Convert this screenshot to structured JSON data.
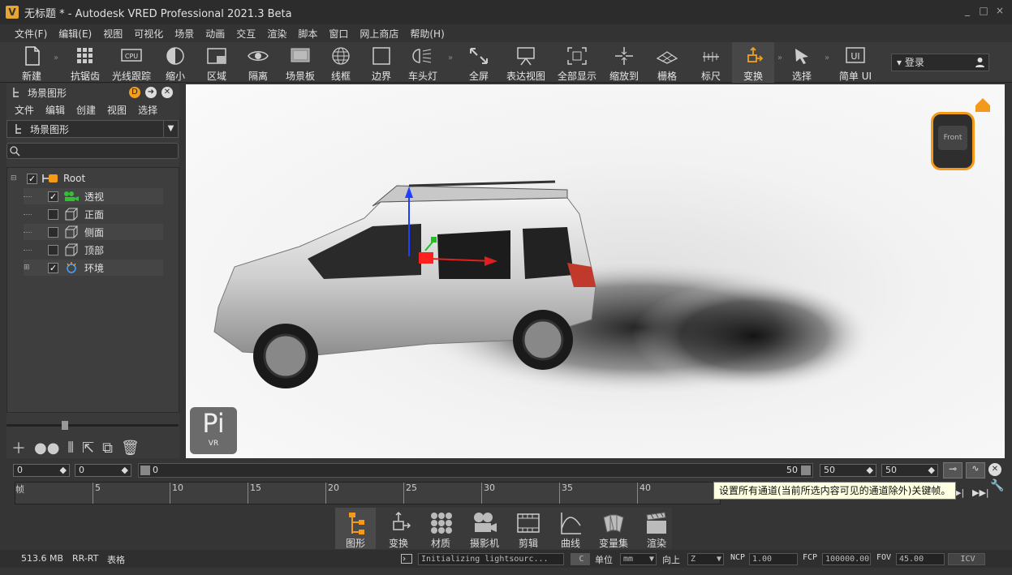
{
  "title": "无标题 * - Autodesk VRED Professional 2021.3 Beta",
  "logo_letter": "V",
  "window_controls": [
    "_",
    "□",
    "×"
  ],
  "menu": [
    "文件(F)",
    "编辑(E)",
    "视图",
    "可视化",
    "场景",
    "动画",
    "交互",
    "渲染",
    "脚本",
    "窗口",
    "网上商店",
    "帮助(H)"
  ],
  "toolbar": {
    "new": "新建",
    "antialias": "抗锯齿",
    "raytrace": "光线跟踪",
    "shrink": "缩小",
    "region": "区域",
    "isolate": "隔离",
    "scene_board": "场景板",
    "wireframe": "线框",
    "boundary": "边界",
    "headlight": "车头灯",
    "fullscreen": "全屏",
    "presentation": "表达视图",
    "show_all": "全部显示",
    "zoom_to": "缩放到",
    "grid": "栅格",
    "ruler": "标尺",
    "transform": "变换",
    "select": "选择",
    "simple_ui": "简单 UI",
    "cpu_badge": "CPU",
    "ui_badge": "UI",
    "login": "登录"
  },
  "scenegraph": {
    "title": "场景图形",
    "menu": [
      "文件",
      "编辑",
      "创建",
      "视图",
      "选择"
    ],
    "selector": "场景图形",
    "search_placeholder": "",
    "tree": [
      {
        "label": "Root",
        "checked": true
      },
      {
        "label": "透视",
        "checked": true
      },
      {
        "label": "正面",
        "checked": false
      },
      {
        "label": "侧面",
        "checked": false
      },
      {
        "label": "顶部",
        "checked": false
      },
      {
        "label": "环境",
        "checked": true
      }
    ]
  },
  "viewport": {
    "cube_face": "Front",
    "watermark": "Pi",
    "watermark_sub": "VR"
  },
  "timeline": {
    "field1": "0",
    "field2": "0",
    "range_start": "0",
    "range_end": "50",
    "field3": "50",
    "field4": "50",
    "ticks": [
      "帧",
      "5",
      "10",
      "15",
      "20",
      "25",
      "30",
      "35",
      "40"
    ],
    "tooltip": "设置所有通道(当前所选内容可见的通道除外)关键帧。"
  },
  "tabs": [
    "图形",
    "变换",
    "材质",
    "摄影机",
    "剪辑",
    "曲线",
    "变量集",
    "渲染"
  ],
  "status": {
    "memory": "513.6 MB",
    "mode": "RR-RT",
    "table": "表格",
    "message": "Initializing lightsourc...",
    "c_btn": "C",
    "unit_label": "单位",
    "unit": "mm",
    "up_label": "向上",
    "up": "Z",
    "ncp_label": "NCP",
    "ncp": "1.00",
    "fcp_label": "FCP",
    "fcp": "100000.00",
    "fov_label": "FOV",
    "fov": "45.00",
    "icv": "ICV"
  }
}
